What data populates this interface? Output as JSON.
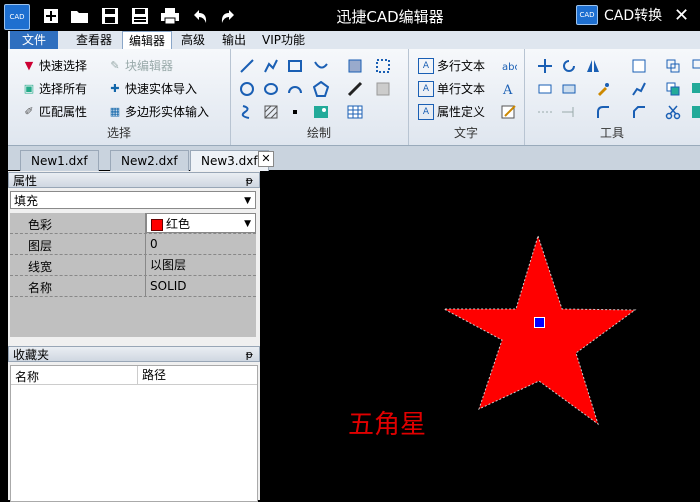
{
  "title_bar": {
    "title": "迅捷CAD编辑器",
    "app_icon": "CAD",
    "quick_access": [
      "new-icon",
      "open-icon",
      "save-icon",
      "save-as-icon",
      "print-icon",
      "undo-icon",
      "redo-icon"
    ],
    "convert_icon": "CAD",
    "convert_label": "CAD转换",
    "close_glyph": "✕"
  },
  "menu": {
    "tabs": [
      "文件",
      "查看器",
      "编辑器",
      "高级",
      "输出",
      "VIP功能"
    ],
    "active": "编辑器"
  },
  "ribbon": {
    "select_group": {
      "label": "选择",
      "buttons": [
        "快速选择",
        "块编辑器",
        "选择所有",
        "快速实体导入",
        "匹配属性",
        "多边形实体输入"
      ]
    },
    "draw_group": {
      "label": "绘制"
    },
    "text_group": {
      "label": "文字",
      "buttons": [
        "多行文本",
        "单行文本",
        "属性定义"
      ]
    },
    "tools_group": {
      "label": "工具"
    }
  },
  "doc_tabs": [
    "New1.dxf",
    "New2.dxf",
    "New3.dxf"
  ],
  "doc_tab_active": "New3.dxf",
  "properties_panel": {
    "title": "属性",
    "pin": "ᵽ",
    "object_type": "填充",
    "rows": [
      {
        "key": "色彩",
        "value": "红色"
      },
      {
        "key": "图层",
        "value": "0"
      },
      {
        "key": "线宽",
        "value": "以图层"
      },
      {
        "key": "名称",
        "value": "SOLID"
      }
    ]
  },
  "favorites_panel": {
    "title": "收藏夹",
    "columns": [
      "名称",
      "路径"
    ]
  },
  "canvas": {
    "annotation": "五角星",
    "star_fill": "#ff0000"
  },
  "colors": {
    "accent": "#2f6fbf",
    "fill": "#ff0000",
    "grip": "#0000ff"
  }
}
